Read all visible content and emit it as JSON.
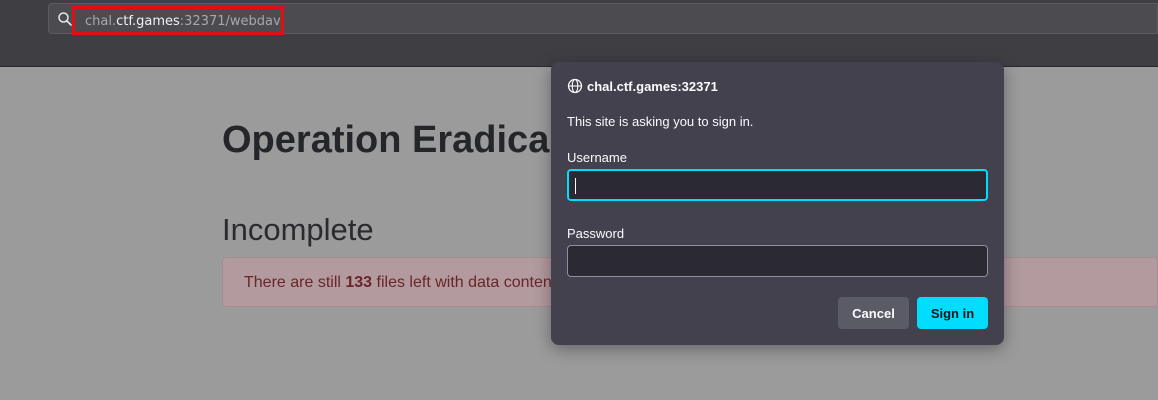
{
  "toolbar": {
    "url_subdomain": "chal.",
    "url_host": "ctf.games",
    "url_rest": ":32371/webdav",
    "search_icon": "search-icon",
    "highlight_color": "#e01010"
  },
  "page": {
    "title": "Operation Eradica",
    "subtitle": "Incomplete",
    "alert": {
      "prefix": "There are still ",
      "count": "133",
      "suffix": " files left with data conten"
    }
  },
  "dialog": {
    "globe_icon": "globe-icon",
    "host": "chal.ctf.games:32371",
    "message": "This site is asking you to sign in.",
    "username_label": "Username",
    "username_value": "",
    "password_label": "Password",
    "password_value": "",
    "cancel_label": "Cancel",
    "signin_label": "Sign in",
    "accent_color": "#00ddff"
  }
}
